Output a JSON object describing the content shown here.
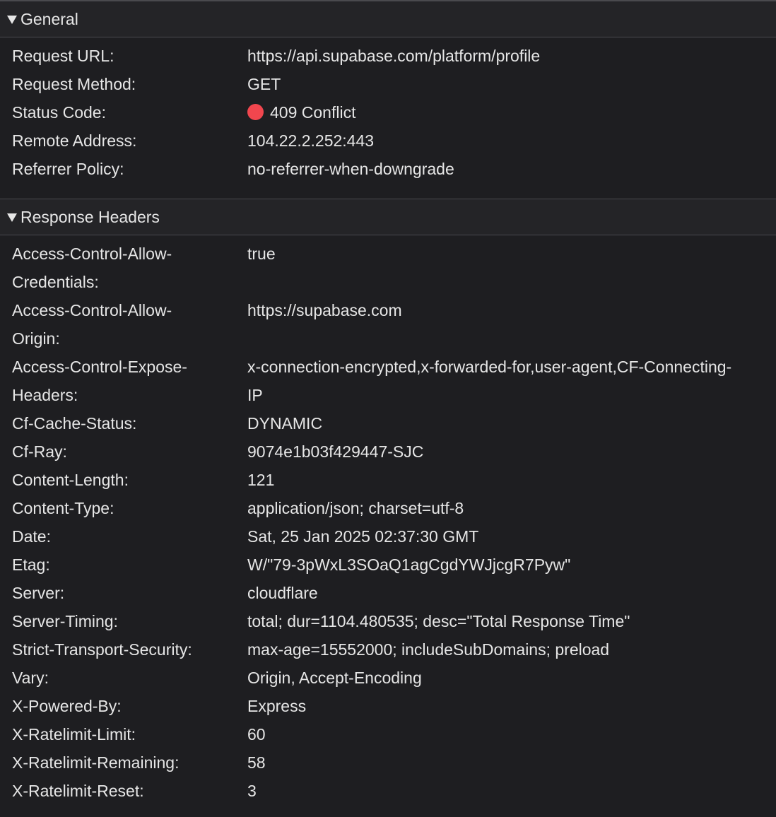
{
  "general": {
    "title": "General",
    "rows": [
      {
        "key": "Request URL:",
        "value": "https://api.supabase.com/platform/profile"
      },
      {
        "key": "Request Method:",
        "value": "GET"
      },
      {
        "key": "Status Code:",
        "value": "409 Conflict"
      },
      {
        "key": "Remote Address:",
        "value": "104.22.2.252:443"
      },
      {
        "key": "Referrer Policy:",
        "value": "no-referrer-when-downgrade"
      }
    ],
    "status_color": "#f1464e"
  },
  "response_headers": {
    "title": "Response Headers",
    "rows": [
      {
        "key": "Access-Control-Allow-Credentials:",
        "value": "true"
      },
      {
        "key": "Access-Control-Allow-Origin:",
        "value": "https://supabase.com"
      },
      {
        "key": "Access-Control-Expose-Headers:",
        "value": "x-connection-encrypted,x-forwarded-for,user-agent,CF-Connecting-IP"
      },
      {
        "key": "Cf-Cache-Status:",
        "value": "DYNAMIC"
      },
      {
        "key": "Cf-Ray:",
        "value": "9074e1b03f429447-SJC"
      },
      {
        "key": "Content-Length:",
        "value": "121"
      },
      {
        "key": "Content-Type:",
        "value": "application/json; charset=utf-8"
      },
      {
        "key": "Date:",
        "value": "Sat, 25 Jan 2025 02:37:30 GMT"
      },
      {
        "key": "Etag:",
        "value": "W/\"79-3pWxL3SOaQ1agCgdYWJjcgR7Pyw\""
      },
      {
        "key": "Server:",
        "value": "cloudflare"
      },
      {
        "key": "Server-Timing:",
        "value": "total; dur=1104.480535; desc=\"Total Response Time\""
      },
      {
        "key": "Strict-Transport-Security:",
        "value": "max-age=15552000; includeSubDomains; preload"
      },
      {
        "key": "Vary:",
        "value": "Origin, Accept-Encoding"
      },
      {
        "key": "X-Powered-By:",
        "value": "Express"
      },
      {
        "key": "X-Ratelimit-Limit:",
        "value": "60"
      },
      {
        "key": "X-Ratelimit-Remaining:",
        "value": "58"
      },
      {
        "key": "X-Ratelimit-Reset:",
        "value": "3"
      }
    ]
  }
}
